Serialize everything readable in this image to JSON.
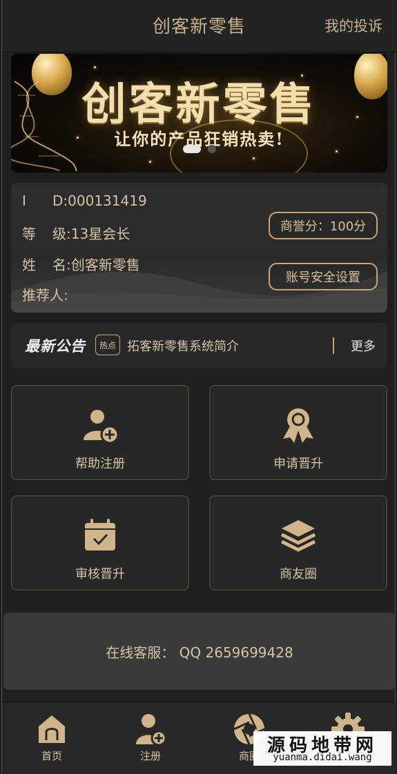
{
  "header": {
    "title": "创客新零售",
    "complaint_link": "我的投诉"
  },
  "banner": {
    "headline": "创客新零售",
    "slogan": "让你的产品狂销热卖!",
    "active_slide": 1,
    "slide_count": 2
  },
  "profile": {
    "id_key_1": "I",
    "id_key_2": "D:",
    "id_value": "000131419",
    "level_key_1": "等",
    "level_key_2": "级:",
    "level_value": "13星会长",
    "name_key_1": "姓",
    "name_key_2": "名:",
    "name_value": "创客新零售",
    "referrer_key": "推荐人:",
    "referrer_value": "",
    "reputation_button": "商誉分：100分",
    "security_button": "账号安全设置"
  },
  "notice": {
    "label": "最新公告",
    "hot_badge": "热点",
    "text": "拓客新零售系统简介",
    "more": "更多"
  },
  "tiles": [
    {
      "label": "帮助注册",
      "icon": "user-add-icon"
    },
    {
      "label": "申请晋升",
      "icon": "award-ribbon-icon"
    },
    {
      "label": "审核晋升",
      "icon": "calendar-check-icon"
    },
    {
      "label": "商友圈",
      "icon": "layers-stack-icon"
    }
  ],
  "service": {
    "text": "在线客服：  QQ 2659699428"
  },
  "tabbar": [
    {
      "label": "首页",
      "icon": "home-icon"
    },
    {
      "label": "注册",
      "icon": "user-add-icon"
    },
    {
      "label": "商圈",
      "icon": "aperture-icon"
    },
    {
      "label": "设置",
      "icon": "gear-icon"
    }
  ],
  "watermark": {
    "title": "源码地带网",
    "url": "yuanma.didai.wang"
  },
  "colors": {
    "accent_gold": "#c9a773",
    "background": "#1f1f1f",
    "card": "#2b2b2b"
  }
}
